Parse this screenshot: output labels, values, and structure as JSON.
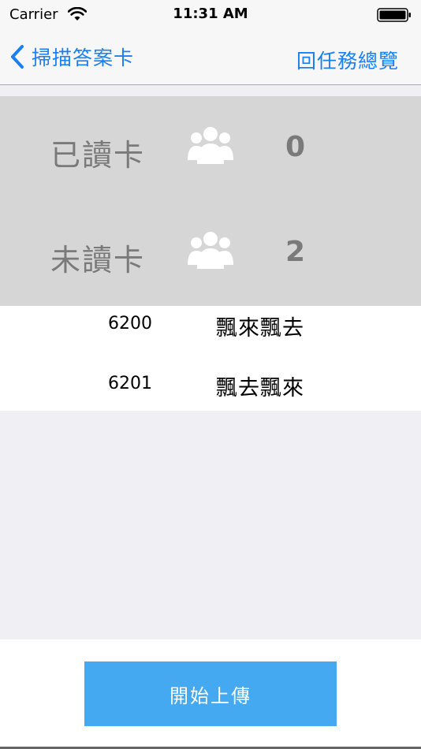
{
  "status_bar": {
    "carrier": "Carrier",
    "time": "11:31 AM",
    "wifi_icon": "wifi-icon",
    "battery_icon": "battery-icon"
  },
  "nav": {
    "back_label": "掃描答案卡",
    "back_icon": "chevron-left-icon",
    "right_label": "回任務總覽",
    "accent_color": "#1a7ff5"
  },
  "stats": [
    {
      "label": "已讀卡",
      "icon": "group-icon",
      "count": "0"
    },
    {
      "label": "未讀卡",
      "icon": "group-icon",
      "count": "2"
    }
  ],
  "students": [
    {
      "id": "6200",
      "name": "飄來飄去"
    },
    {
      "id": "6201",
      "name": "飄去飄來"
    }
  ],
  "upload_button": {
    "label": "開始上傳",
    "color": "#45a9f2"
  }
}
